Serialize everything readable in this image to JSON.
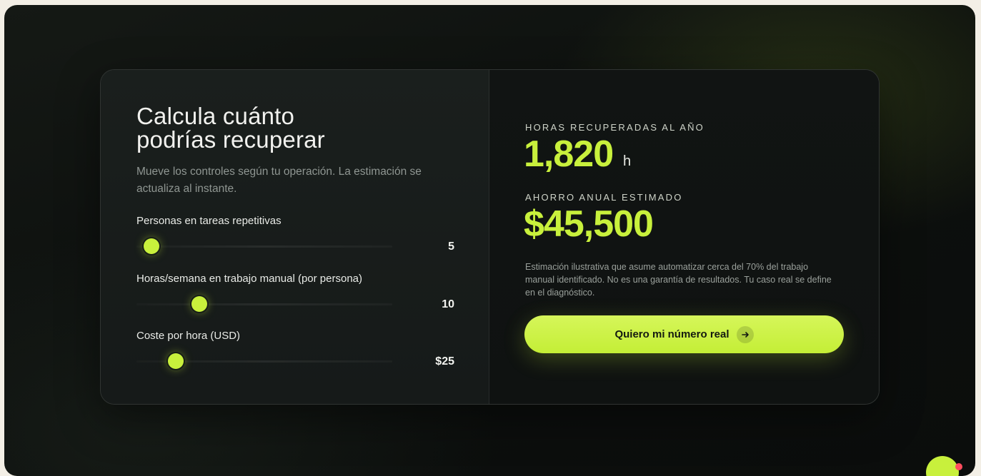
{
  "calculator": {
    "title_line1": "Calcula cuánto",
    "title_line2": "podrías recuperar",
    "subtitle": "Mueve los controles según tu operación. La estimación se actualiza al instante.",
    "controls": [
      {
        "label": "Personas en tareas repetitivas",
        "value_text": "5",
        "position_fraction": 0.06
      },
      {
        "label": "Horas/semana en trabajo manual (por persona)",
        "value_text": "10",
        "position_fraction": 0.245
      },
      {
        "label": "Coste por hora (USD)",
        "value_text": "$25",
        "position_fraction": 0.155
      }
    ]
  },
  "results": {
    "hours_label": "HORAS RECUPERADAS AL AÑO",
    "hours_value": "1,820",
    "hours_unit": "h",
    "savings_label": "AHORRO ANUAL ESTIMADO",
    "savings_value": "$45,500",
    "disclaimer": "Estimación ilustrativa que asume automatizar cerca del 70% del trabajo manual identificado. No es una garantía de resultados. Tu caso real se define en el diagnóstico.",
    "cta_label": "Quiero mi número real",
    "cta_icon": "arrow-right-icon"
  },
  "colors": {
    "accent": "#c8f03c",
    "card_bg": "#141816",
    "page_bg": "#0d100e",
    "notification_dot": "#ff4d5e"
  }
}
